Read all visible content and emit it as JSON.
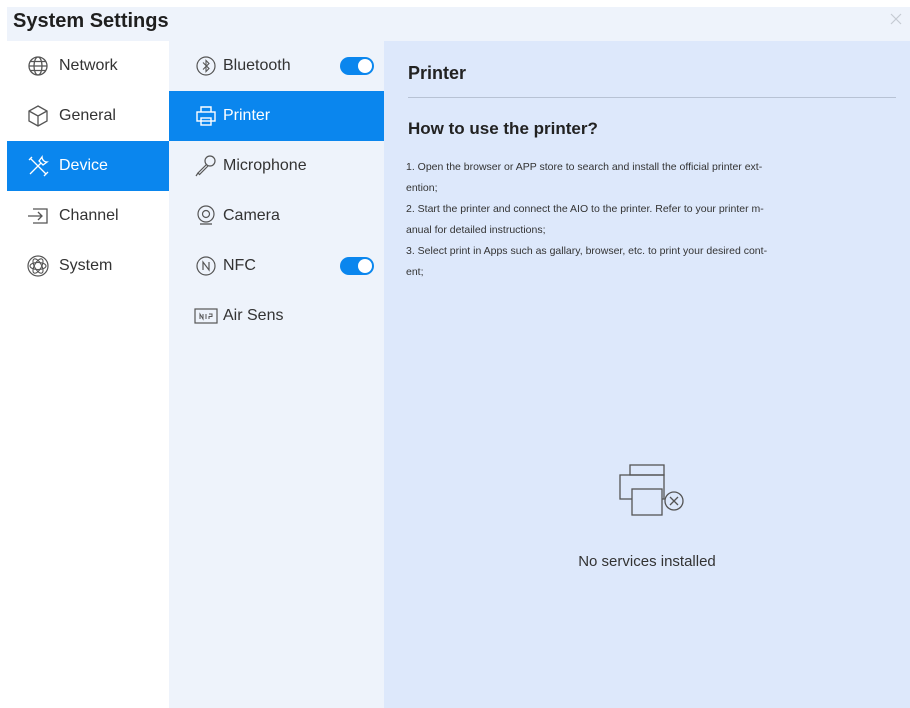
{
  "window": {
    "title": "System Settings"
  },
  "left_nav": {
    "items": [
      {
        "label": "Network",
        "icon": "globe-icon",
        "active": false
      },
      {
        "label": "General",
        "icon": "cube-icon",
        "active": false
      },
      {
        "label": "Device",
        "icon": "tools-icon",
        "active": true
      },
      {
        "label": "Channel",
        "icon": "input-arrow-icon",
        "active": false
      },
      {
        "label": "System",
        "icon": "atom-icon",
        "active": false
      }
    ]
  },
  "device_nav": {
    "items": [
      {
        "label": "Bluetooth",
        "icon": "bluetooth-icon",
        "toggle": true
      },
      {
        "label": "Printer",
        "icon": "printer-icon",
        "active": true
      },
      {
        "label": "Microphone",
        "icon": "microphone-icon"
      },
      {
        "label": "Camera",
        "icon": "camera-icon"
      },
      {
        "label": "NFC",
        "icon": "nfc-icon",
        "toggle": true
      },
      {
        "label": "Air Sens",
        "icon": "air-sensor-icon"
      }
    ]
  },
  "detail": {
    "title": "Printer",
    "howto_heading": "How to use the printer?",
    "steps": [
      "1. Open the browser or APP store to search and install the official printer ext-",
      "ention;",
      "2. Start the printer and connect the AIO to the printer. Refer to your printer m-",
      "anual for detailed instructions;",
      "3. Select print in Apps such as gallary, browser, etc. to print your desired cont-",
      "ent;"
    ],
    "empty_state": "No services installed"
  },
  "colors": {
    "accent": "#0a86ee",
    "background": "#eef3fb",
    "detail_background": "#dde8fb"
  }
}
